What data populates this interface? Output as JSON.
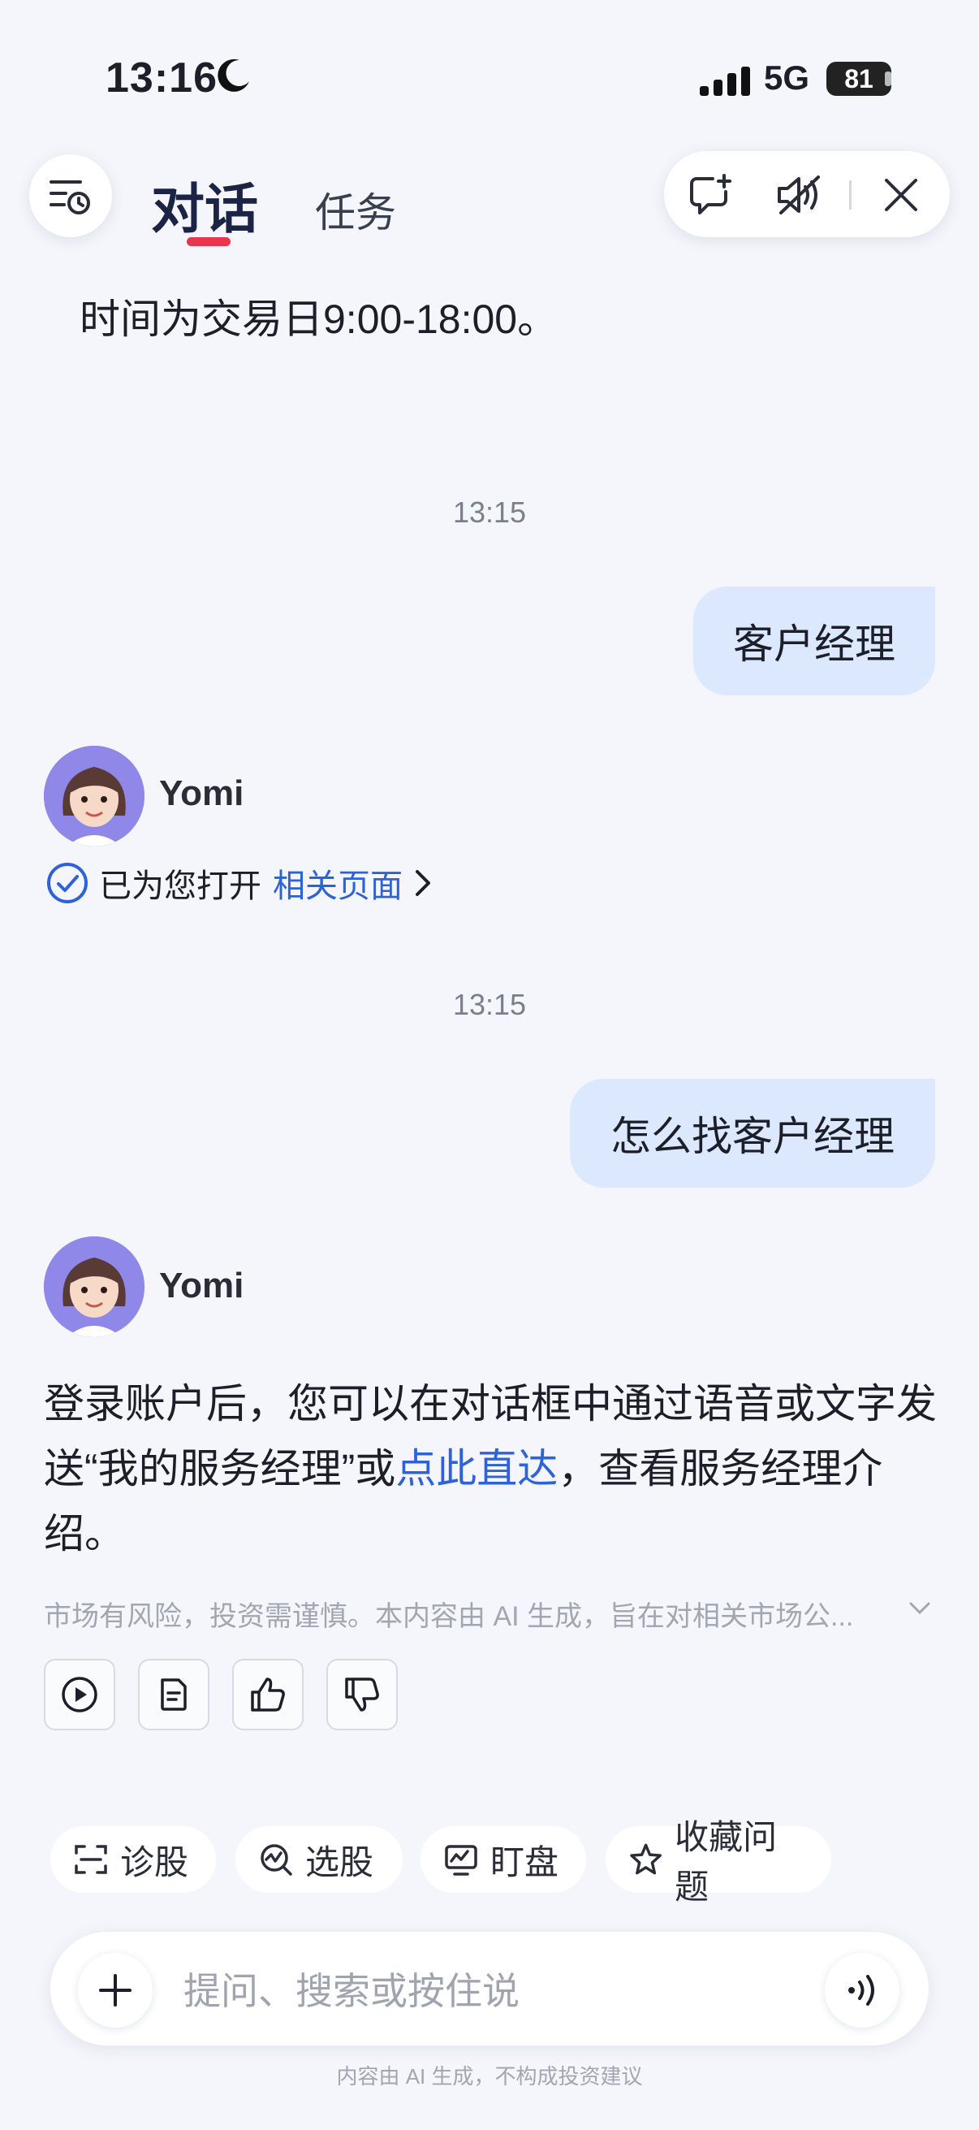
{
  "status_bar": {
    "time": "13:16",
    "network": "5G",
    "battery": "81"
  },
  "header": {
    "tab_active": "对话",
    "tab_inactive": "任务"
  },
  "messages": {
    "prev_answer_tail": "时间为交易日9:00-18:00。",
    "timestamp_1": "13:15",
    "user_msg_1": "客户经理",
    "bot_name_1": "Yomi",
    "open_prefix": "已为您打开",
    "open_link": "相关页面",
    "timestamp_2": "13:15",
    "user_msg_2": "怎么找客户经理",
    "bot_name_2": "Yomi",
    "answer_part1": "登录账户后，您可以在对话框中通过语音或文字发送“我的服务经理”或",
    "answer_link": "点此直达",
    "answer_part2": "，查看服务经理介绍。",
    "risk_disclaimer": "市场有风险，投资需谨慎。本内容由 AI 生成，旨在对相关市场公..."
  },
  "chips": [
    "诊股",
    "选股",
    "盯盘",
    "收藏问题"
  ],
  "input": {
    "placeholder": "提问、搜索或按住说"
  },
  "footer_note": "内容由 AI 生成，不构成投资建议",
  "colors": {
    "accent_red": "#e8364b",
    "link_blue": "#2d62d8",
    "bubble_blue": "#dce8fd"
  }
}
